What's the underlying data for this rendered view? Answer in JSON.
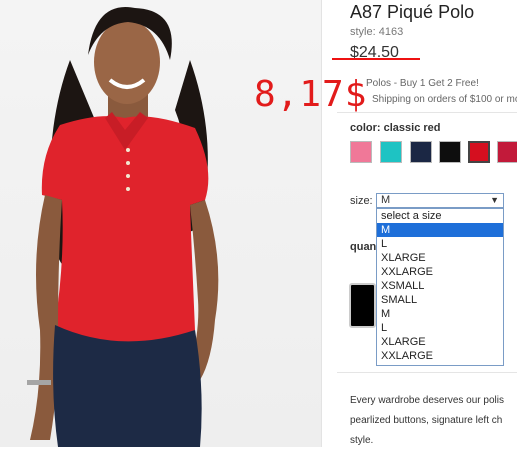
{
  "product": {
    "title": "A87 Piqué Polo",
    "style": "style: 4163",
    "price": "$24.50",
    "overlay_price": "8,17$",
    "promo_1": "Polos - Buy 1 Get 2 Free!",
    "promo_2": "Shipping on orders of $100 or mo"
  },
  "color": {
    "label": "color:",
    "value": "classic red",
    "swatches": [
      {
        "name": "pink",
        "hex": "#f07898"
      },
      {
        "name": "teal",
        "hex": "#1ec3c3"
      },
      {
        "name": "navy",
        "hex": "#1b2744"
      },
      {
        "name": "black",
        "hex": "#0e0e0e"
      },
      {
        "name": "classic red",
        "hex": "#d50f1f",
        "selected": true
      },
      {
        "name": "crimson",
        "hex": "#c21a3a"
      }
    ]
  },
  "size": {
    "label": "size:",
    "selected": "M",
    "options": [
      "select a size",
      "M",
      "L",
      "XLARGE",
      "XXLARGE",
      "XSMALL",
      "SMALL",
      "M",
      "L",
      "XLARGE",
      "XXLARGE"
    ],
    "highlighted_index": 1
  },
  "quantity": {
    "label": "quan"
  },
  "description": {
    "line1": "Every wardrobe deserves our polis",
    "line2": "pearlized buttons, signature left ch",
    "line3": "style."
  }
}
